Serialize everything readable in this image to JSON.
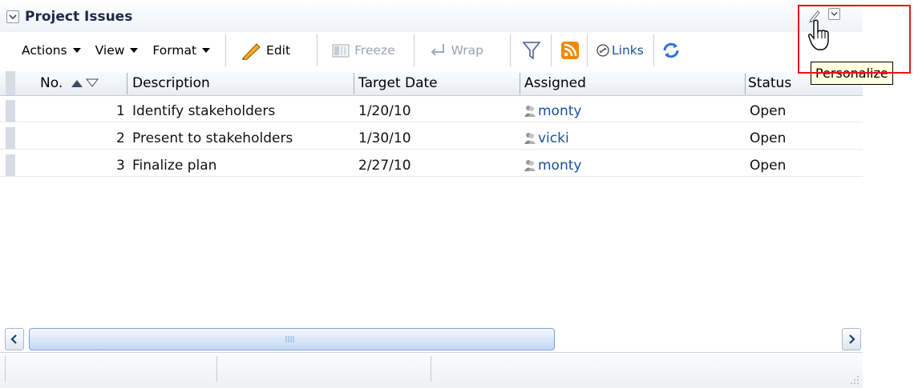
{
  "panel": {
    "title": "Project Issues"
  },
  "toolbar": {
    "actions_label": "Actions",
    "view_label": "View",
    "format_label": "Format",
    "edit_label": "Edit",
    "freeze_label": "Freeze",
    "wrap_label": "Wrap",
    "links_label": "Links"
  },
  "columns": {
    "no": "No.",
    "description": "Description",
    "target_date": "Target Date",
    "assigned": "Assigned",
    "status": "Status"
  },
  "rows": [
    {
      "no": "1",
      "description": "Identify stakeholders",
      "target_date": "1/20/10",
      "assigned": "monty",
      "status": "Open"
    },
    {
      "no": "2",
      "description": "Present to stakeholders",
      "target_date": "1/30/10",
      "assigned": "vicki",
      "status": "Open"
    },
    {
      "no": "3",
      "description": "Finalize plan",
      "target_date": "2/27/10",
      "assigned": "monty",
      "status": "Open"
    }
  ],
  "tooltip": {
    "text": "Personalize"
  },
  "colors": {
    "highlight": "#e8141a",
    "link": "#1c4f9c",
    "title": "#1e2b47"
  },
  "icons": [
    "collapse-icon",
    "pencil-icon",
    "freeze-icon",
    "wrap-icon",
    "filter-icon",
    "rss-icon",
    "links-icon",
    "refresh-icon",
    "personalize-icon",
    "menu-icon",
    "user-icon",
    "hand-cursor-icon"
  ]
}
